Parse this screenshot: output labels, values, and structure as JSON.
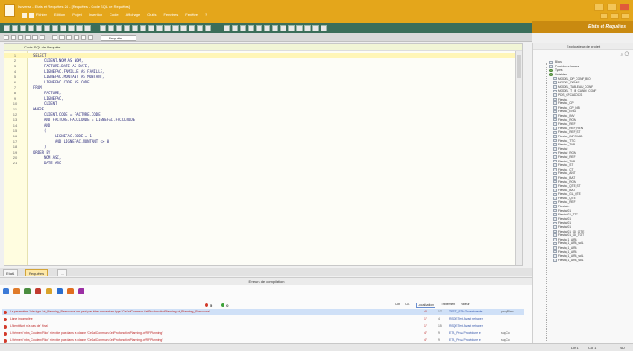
{
  "title": "Isoverse - Etats et Requêtes 24 - [Requêtes - Code SQL de Requêtes]",
  "menu": [
    "Fichier",
    "Edition",
    "Projet",
    "Insertion",
    "Code",
    "Affichage",
    "Outils",
    "Fenêtres",
    "Fenêtre",
    "?"
  ],
  "brand": "Etats et Requêtes",
  "toolbar": {
    "request_tab": "Requête"
  },
  "editor": {
    "header": "Code SQL de Requête",
    "lines": [
      {
        "n": "1",
        "code": "SELECT",
        "indent": 0
      },
      {
        "n": "2",
        "code": "CLIENT.NOM AS NOM,",
        "indent": 1
      },
      {
        "n": "3",
        "code": "FACTURE.DATE AS DATE,",
        "indent": 1
      },
      {
        "n": "4",
        "code": "LIGNEFAC.FAMILLE AS FAMILLE,",
        "indent": 1
      },
      {
        "n": "5",
        "code": "LIGNEFAC.MONTANT AS MONTANT,",
        "indent": 1
      },
      {
        "n": "6",
        "code": "LIGNEFAC.CODE AS CODE",
        "indent": 1
      },
      {
        "n": "7",
        "code": "FROM",
        "indent": 0
      },
      {
        "n": "8",
        "code": "FACTURE,",
        "indent": 1
      },
      {
        "n": "9",
        "code": "LIGNEFAC,",
        "indent": 1
      },
      {
        "n": "10",
        "code": "CLIENT",
        "indent": 1
      },
      {
        "n": "11",
        "code": "WHERE",
        "indent": 0
      },
      {
        "n": "12",
        "code": "CLIENT.CODE = FACTURE.CODE",
        "indent": 1
      },
      {
        "n": "13",
        "code": "AND      FACTURE.FACCLOUDE = LIGNEFAC.FACCLOUDE",
        "indent": 1
      },
      {
        "n": "14",
        "code": "AND",
        "indent": 1
      },
      {
        "n": "15",
        "code": "(",
        "indent": 1
      },
      {
        "n": "16",
        "code": "LIGNEFAC.CODE = 1",
        "indent": 2
      },
      {
        "n": "17",
        "code": "AND LIGNEFAC.MONTANT <> 0",
        "indent": 2
      },
      {
        "n": "18",
        "code": ")",
        "indent": 1
      },
      {
        "n": "19",
        "code": "ORDER BY",
        "indent": 0
      },
      {
        "n": "20",
        "code": "NOM ASC,",
        "indent": 1
      },
      {
        "n": "21",
        "code": "DATE ASC",
        "indent": 1
      }
    ]
  },
  "project": {
    "title": "Explorateur de projet",
    "items": [
      "Blocs",
      "Procédures locales",
      "Types",
      "Variables",
      "MODEL_DP_CONF_BIO",
      "MODEL_DPVAF",
      "MODEL_TABLEAU_CONF",
      "MODEL_T_IB_CANDI_CONF",
      "PDS_CFCADOCS",
      "Fiesta1",
      "Fiesta1_CP",
      "Fiesta1_CP_INB",
      "Fiesta1_ENG",
      "Fiesta1_INV",
      "Fiesta1_ROM",
      "Fiesta1_REF",
      "Fiesta1_REF_REN",
      "Fiesta1_REF_ST",
      "Fiesta1_INFOHAB",
      "Fiesta1_TTC",
      "Fiesta1_TAB",
      "Fiesta2",
      "Fiesta2_RGM",
      "Fiesta2_REF",
      "Fiesta2_TAB",
      "Fiesta1_ST",
      "Fiesta1_CT",
      "Fiesta1_ANT",
      "Fiesta1_BAT",
      "Fiesta1_ROM",
      "Fiesta1_QTE_ST",
      "Fiesta1_BAT",
      "Fiesta1_GL_QTE",
      "Fiesta1_QTE",
      "Fiesta1_REF",
      "Fiesta2n",
      "Fiesta201",
      "Fiesta201_TTC",
      "Fiesta201",
      "Fiesta201",
      "Fiesta201",
      "Fiesta201_GL_QTE",
      "Fiesta201_GL_TOT",
      "Fiesta_1_ARB",
      "Fiesta_1_ARB_sdL",
      "Fiesta_1_ARB",
      "Fiesta_1_ARB",
      "Fiesta_1_ARB_sdL",
      "Fiesta_1_ARB_sdL"
    ]
  },
  "bottom_tabs": [
    "Etat1",
    "Requêtes",
    "..."
  ],
  "compile": {
    "title": "Erreurs de compilation",
    "error_count": "5",
    "ok_count": "0",
    "columns": [
      "Cib",
      "Col.",
      "Localisation",
      "Traitement",
      "Valeur"
    ],
    "rows": [
      {
        "msg": "Le paramètre 1 de type 'ot_Planning_Ressource' ne peut pas être converti en type 'CeSalCommun.CeiPro.fonctionPlanning.ot_Planning_Ressource'.",
        "num": "44",
        "col": "17",
        "loc": "TEST_ETA Ouverture de",
        "tr": "progPlan"
      },
      {
        "msg": "Ligne incomplète",
        "num": "17",
        "col": "4",
        "loc": "REQETest Avant rehaper",
        "tr": ""
      },
      {
        "msg": "L'identifiant n'a pas de ' fina'.",
        "num": "17",
        "col": "15",
        "loc": "REQETest Avant rehaper",
        "tr": ""
      },
      {
        "msg": "L'élément 'nbs_Couleur/Rice' n'existe pas dans la classe 'CeSalCommun.CeiPro.fonctionPlanning.ot/RFPlanning'.",
        "num": "47",
        "col": "9",
        "loc": "ETA_ProA Procédure le",
        "tr": "supCo"
      },
      {
        "msg": "L'élément 'nbs_Couleur/Rice' n'existe pas dans la classe 'CeSalCommun.CeiPro.fonctionPlanning.ot/RFPlanning'.",
        "num": "47",
        "col": "9",
        "loc": "ETA_ProA Procédure le",
        "tr": "supCo"
      }
    ]
  },
  "status": {
    "line": "Lin 1",
    "col": "Col 1",
    "mode": "NU"
  }
}
